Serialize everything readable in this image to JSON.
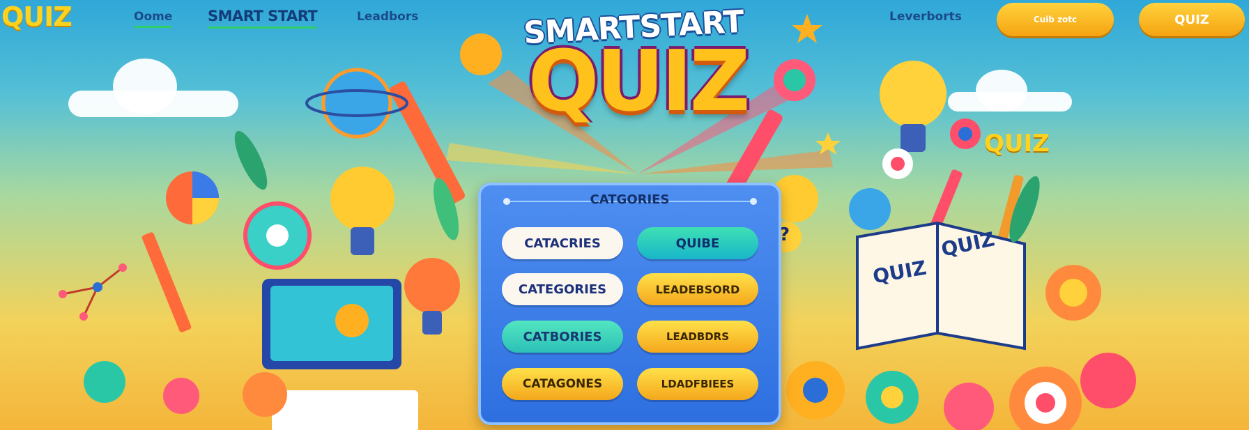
{
  "nav": {
    "logo": "QUIZ",
    "links": [
      {
        "label": "Oome"
      },
      {
        "label": "SMART START"
      },
      {
        "label": "Leadbors"
      }
    ],
    "right_link": "Leverborts",
    "button1": "Cuib zotc",
    "button2": "QUIZ"
  },
  "hero": {
    "title_small": "SMARTSTART",
    "title_big": "QUIZ"
  },
  "panel": {
    "title": "CATGORIES",
    "buttons": [
      {
        "label": "CATACRIES"
      },
      {
        "label": "QUIBE"
      },
      {
        "label": "CATEGORIES"
      },
      {
        "label": "LEADEBSORD"
      },
      {
        "label": "CATBORIES"
      },
      {
        "label": "LEADBDRS"
      },
      {
        "label": "CATAGONES"
      },
      {
        "label": "LDADFBIEES"
      }
    ]
  },
  "decor": {
    "side_quiz": "QUIZ",
    "book_word_left": "QUIZ",
    "book_word_right": "QUIZ",
    "question_mark": "?"
  },
  "colors": {
    "accent_gold": "#ffc21c",
    "panel_blue": "#2d6fe0",
    "nav_underline": "#2ecf69"
  }
}
